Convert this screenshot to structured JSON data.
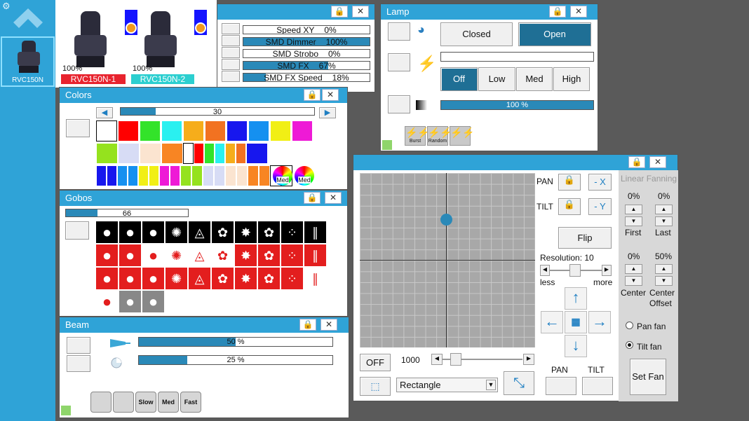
{
  "sidebar": {
    "fixture_name": "RVC150N"
  },
  "stage": {
    "fixtures": [
      {
        "level": "100%",
        "name": "RVC150N-1",
        "color": "#e8232e"
      },
      {
        "level": "100%",
        "name": "RVC150N-2",
        "color": "#2ccfd0"
      }
    ]
  },
  "sliders": {
    "rows": [
      {
        "label": "Speed XY",
        "value": "0%",
        "level": 0
      },
      {
        "label": "SMD Dimmer",
        "value": "100%",
        "level": 100
      },
      {
        "label": "SMD Strobo",
        "value": "0%",
        "level": 0
      },
      {
        "label": "SMD FX",
        "value": "67%",
        "level": 67
      },
      {
        "label": "SMD FX Speed",
        "value": "18%",
        "level": 18
      }
    ]
  },
  "lamp": {
    "title": "Lamp",
    "closed": "Closed",
    "open": "Open",
    "speeds": [
      "Off",
      "Low",
      "Med",
      "High"
    ],
    "dimmer_text": "100 %",
    "dimmer_level": 100,
    "effects": [
      "Burst",
      "Random",
      ""
    ]
  },
  "colors": {
    "title": "Colors",
    "slider_value": "30",
    "slider_level": 18,
    "med1": "Med",
    "med2": "Med"
  },
  "gobos": {
    "title": "Gobos",
    "slider_value": "66",
    "slider_level": 26
  },
  "beam": {
    "title": "Beam",
    "zoom_text": "50 %",
    "zoom_level": 50,
    "focus_text": "25 %",
    "focus_level": 25,
    "buttons": [
      "",
      "",
      "Slow",
      "Med",
      "Fast"
    ]
  },
  "pantilt": {
    "pan": "PAN",
    "tilt": "TILT",
    "minus_x": "- X",
    "minus_y": "- Y",
    "flip": "Flip",
    "resolution": "Resolution: 10",
    "less": "less",
    "more": "more",
    "off": "OFF",
    "speed": "1000",
    "shape": "Rectangle",
    "pan_btn": "PAN",
    "tilt_btn": "TILT",
    "fan_title": "Linear Fanning",
    "first_val": "0%",
    "last_val": "0%",
    "first": "First",
    "last": "Last",
    "center_val": "0%",
    "offset_val": "50%",
    "center": "Center",
    "center_offset": "Center Offset",
    "pan_fan": "Pan fan",
    "tilt_fan": "Tilt fan",
    "set_fan": "Set Fan"
  },
  "colors_palette": {
    "accent": "#2fa3d7",
    "fill": "#2a89b8"
  }
}
